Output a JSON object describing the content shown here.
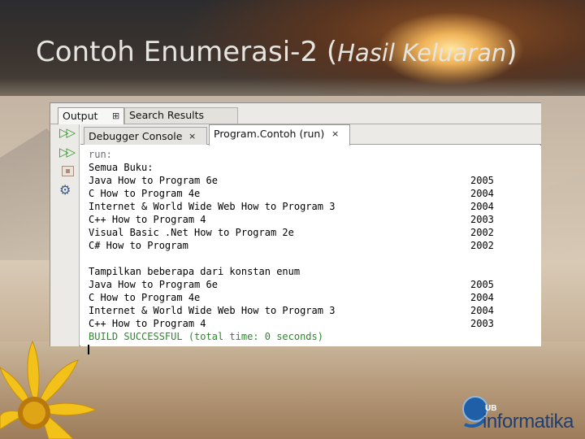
{
  "slide": {
    "title_main": "Contoh Enumerasi-2 (",
    "title_italic": "Hasil Keluaran",
    "title_end": ")"
  },
  "ide": {
    "top_tabs": {
      "output": "Output",
      "search_results": "Search Results"
    },
    "inner_tabs": {
      "debugger": "Debugger Console",
      "program": "Program.Contoh (run)"
    },
    "close_glyph": "×",
    "console": {
      "run_line": "run:",
      "section1_header": "Semua Buku:",
      "section1_rows": [
        {
          "title": "Java How to Program 6e",
          "year": "2005"
        },
        {
          "title": "C How to Program 4e",
          "year": "2004"
        },
        {
          "title": "Internet & World Wide Web How to Program 3",
          "year": "2004"
        },
        {
          "title": "C++ How to Program 4",
          "year": "2003"
        },
        {
          "title": "Visual Basic .Net How to Program 2e",
          "year": "2002"
        },
        {
          "title": "C# How to Program",
          "year": "2002"
        }
      ],
      "section2_header": "Tampilkan beberapa dari konstan enum",
      "section2_rows": [
        {
          "title": "Java How to Program 6e",
          "year": "2005"
        },
        {
          "title": "C How to Program 4e",
          "year": "2004"
        },
        {
          "title": "Internet & World Wide Web How to Program 3",
          "year": "2004"
        },
        {
          "title": "C++ How to Program 4",
          "year": "2003"
        }
      ],
      "build_line": "BUILD SUCCESSFUL (total time: 0 seconds)"
    },
    "toolbar_icons": [
      "rerun-icon",
      "rerun-with-options-icon",
      "stop-icon",
      "settings-icon"
    ]
  },
  "logo": {
    "ub": "UB",
    "text": "informatika"
  },
  "colors": {
    "build_success": "#2a8a2a",
    "run_text": "#6a6a6a",
    "run_icon": "#2f9a26",
    "logo_blue": "#1f3f73"
  }
}
